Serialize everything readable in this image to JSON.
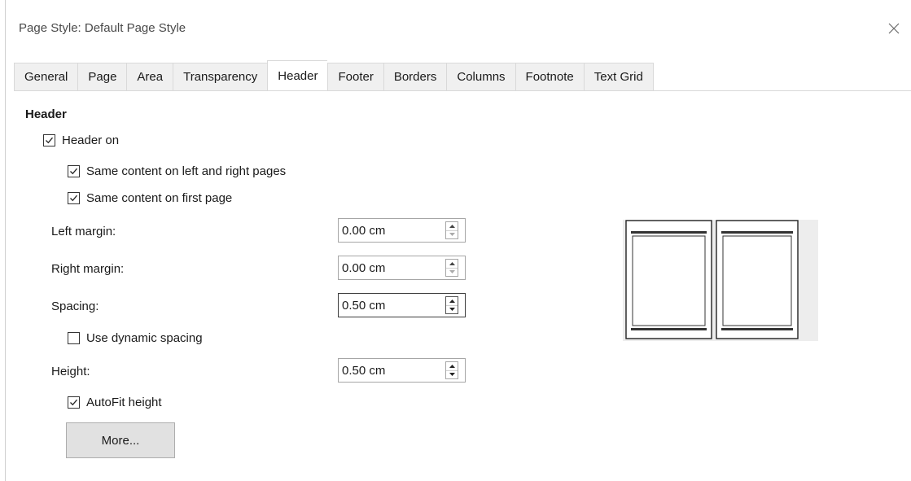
{
  "window": {
    "title": "Page Style: Default Page Style"
  },
  "tabs": [
    "General",
    "Page",
    "Area",
    "Transparency",
    "Header",
    "Footer",
    "Borders",
    "Columns",
    "Footnote",
    "Text Grid"
  ],
  "active_tab": "Header",
  "section": {
    "title": "Header"
  },
  "checks": {
    "header_on": {
      "label": "Header on",
      "checked": true
    },
    "same_left_right": {
      "label": "Same content on left and right pages",
      "checked": true
    },
    "same_first": {
      "label": "Same content on first page",
      "checked": true
    },
    "dynamic_spacing": {
      "label": "Use dynamic spacing",
      "checked": false
    },
    "autofit": {
      "label": "AutoFit height",
      "checked": true
    }
  },
  "fields": {
    "left_margin": {
      "label": "Left margin:",
      "value": "0.00 cm"
    },
    "right_margin": {
      "label": "Right margin:",
      "value": "0.00 cm"
    },
    "spacing": {
      "label": "Spacing:",
      "value": "0.50 cm"
    },
    "height": {
      "label": "Height:",
      "value": "0.50 cm"
    }
  },
  "buttons": {
    "more": "More..."
  },
  "icons": {
    "close": "close-icon",
    "check": "checkmark-icon",
    "up": "arrow-up-icon",
    "down": "arrow-down-icon"
  }
}
